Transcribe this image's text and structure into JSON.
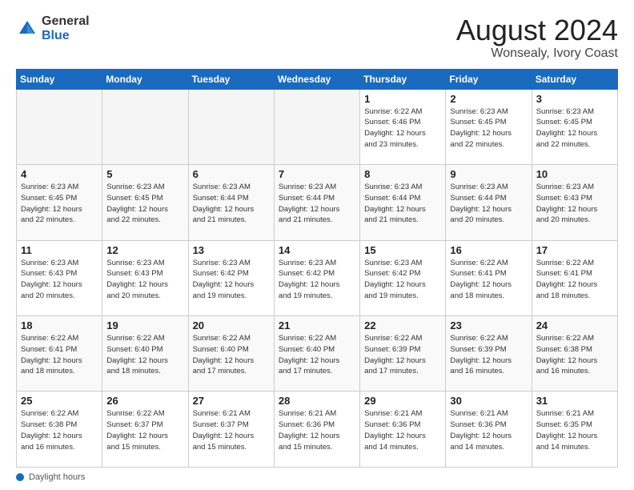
{
  "header": {
    "logo_general": "General",
    "logo_blue": "Blue",
    "title": "August 2024",
    "location": "Wonsealy, Ivory Coast"
  },
  "days_of_week": [
    "Sunday",
    "Monday",
    "Tuesday",
    "Wednesday",
    "Thursday",
    "Friday",
    "Saturday"
  ],
  "weeks": [
    [
      {
        "day": "",
        "info": ""
      },
      {
        "day": "",
        "info": ""
      },
      {
        "day": "",
        "info": ""
      },
      {
        "day": "",
        "info": ""
      },
      {
        "day": "1",
        "info": "Sunrise: 6:22 AM\nSunset: 6:46 PM\nDaylight: 12 hours\nand 23 minutes."
      },
      {
        "day": "2",
        "info": "Sunrise: 6:23 AM\nSunset: 6:45 PM\nDaylight: 12 hours\nand 22 minutes."
      },
      {
        "day": "3",
        "info": "Sunrise: 6:23 AM\nSunset: 6:45 PM\nDaylight: 12 hours\nand 22 minutes."
      }
    ],
    [
      {
        "day": "4",
        "info": "Sunrise: 6:23 AM\nSunset: 6:45 PM\nDaylight: 12 hours\nand 22 minutes."
      },
      {
        "day": "5",
        "info": "Sunrise: 6:23 AM\nSunset: 6:45 PM\nDaylight: 12 hours\nand 22 minutes."
      },
      {
        "day": "6",
        "info": "Sunrise: 6:23 AM\nSunset: 6:44 PM\nDaylight: 12 hours\nand 21 minutes."
      },
      {
        "day": "7",
        "info": "Sunrise: 6:23 AM\nSunset: 6:44 PM\nDaylight: 12 hours\nand 21 minutes."
      },
      {
        "day": "8",
        "info": "Sunrise: 6:23 AM\nSunset: 6:44 PM\nDaylight: 12 hours\nand 21 minutes."
      },
      {
        "day": "9",
        "info": "Sunrise: 6:23 AM\nSunset: 6:44 PM\nDaylight: 12 hours\nand 20 minutes."
      },
      {
        "day": "10",
        "info": "Sunrise: 6:23 AM\nSunset: 6:43 PM\nDaylight: 12 hours\nand 20 minutes."
      }
    ],
    [
      {
        "day": "11",
        "info": "Sunrise: 6:23 AM\nSunset: 6:43 PM\nDaylight: 12 hours\nand 20 minutes."
      },
      {
        "day": "12",
        "info": "Sunrise: 6:23 AM\nSunset: 6:43 PM\nDaylight: 12 hours\nand 20 minutes."
      },
      {
        "day": "13",
        "info": "Sunrise: 6:23 AM\nSunset: 6:42 PM\nDaylight: 12 hours\nand 19 minutes."
      },
      {
        "day": "14",
        "info": "Sunrise: 6:23 AM\nSunset: 6:42 PM\nDaylight: 12 hours\nand 19 minutes."
      },
      {
        "day": "15",
        "info": "Sunrise: 6:23 AM\nSunset: 6:42 PM\nDaylight: 12 hours\nand 19 minutes."
      },
      {
        "day": "16",
        "info": "Sunrise: 6:22 AM\nSunset: 6:41 PM\nDaylight: 12 hours\nand 18 minutes."
      },
      {
        "day": "17",
        "info": "Sunrise: 6:22 AM\nSunset: 6:41 PM\nDaylight: 12 hours\nand 18 minutes."
      }
    ],
    [
      {
        "day": "18",
        "info": "Sunrise: 6:22 AM\nSunset: 6:41 PM\nDaylight: 12 hours\nand 18 minutes."
      },
      {
        "day": "19",
        "info": "Sunrise: 6:22 AM\nSunset: 6:40 PM\nDaylight: 12 hours\nand 18 minutes."
      },
      {
        "day": "20",
        "info": "Sunrise: 6:22 AM\nSunset: 6:40 PM\nDaylight: 12 hours\nand 17 minutes."
      },
      {
        "day": "21",
        "info": "Sunrise: 6:22 AM\nSunset: 6:40 PM\nDaylight: 12 hours\nand 17 minutes."
      },
      {
        "day": "22",
        "info": "Sunrise: 6:22 AM\nSunset: 6:39 PM\nDaylight: 12 hours\nand 17 minutes."
      },
      {
        "day": "23",
        "info": "Sunrise: 6:22 AM\nSunset: 6:39 PM\nDaylight: 12 hours\nand 16 minutes."
      },
      {
        "day": "24",
        "info": "Sunrise: 6:22 AM\nSunset: 6:38 PM\nDaylight: 12 hours\nand 16 minutes."
      }
    ],
    [
      {
        "day": "25",
        "info": "Sunrise: 6:22 AM\nSunset: 6:38 PM\nDaylight: 12 hours\nand 16 minutes."
      },
      {
        "day": "26",
        "info": "Sunrise: 6:22 AM\nSunset: 6:37 PM\nDaylight: 12 hours\nand 15 minutes."
      },
      {
        "day": "27",
        "info": "Sunrise: 6:21 AM\nSunset: 6:37 PM\nDaylight: 12 hours\nand 15 minutes."
      },
      {
        "day": "28",
        "info": "Sunrise: 6:21 AM\nSunset: 6:36 PM\nDaylight: 12 hours\nand 15 minutes."
      },
      {
        "day": "29",
        "info": "Sunrise: 6:21 AM\nSunset: 6:36 PM\nDaylight: 12 hours\nand 14 minutes."
      },
      {
        "day": "30",
        "info": "Sunrise: 6:21 AM\nSunset: 6:36 PM\nDaylight: 12 hours\nand 14 minutes."
      },
      {
        "day": "31",
        "info": "Sunrise: 6:21 AM\nSunset: 6:35 PM\nDaylight: 12 hours\nand 14 minutes."
      }
    ]
  ],
  "footer": {
    "label": "Daylight hours"
  }
}
